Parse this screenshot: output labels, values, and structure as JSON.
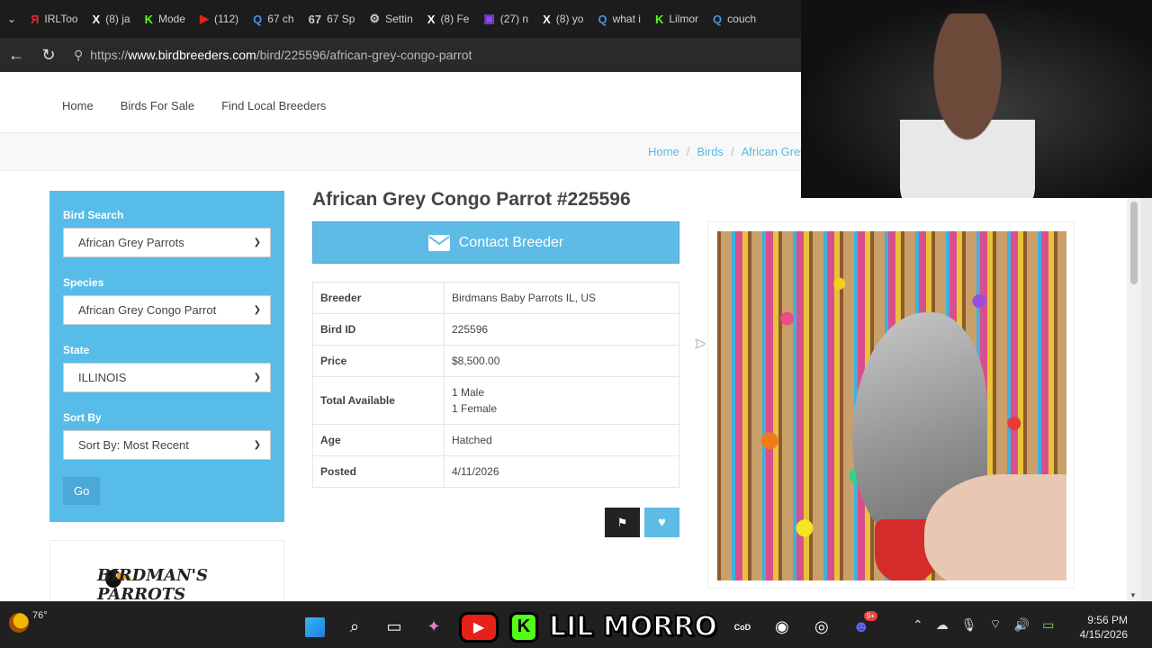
{
  "browser": {
    "tabs": [
      {
        "icon": "Я",
        "icon_color": "#e8262b",
        "label": "IRLToo"
      },
      {
        "icon": "X",
        "icon_color": "#ffffff",
        "label": "(8) ja"
      },
      {
        "icon": "K",
        "icon_color": "#53fc18",
        "label": "Mode"
      },
      {
        "icon": "▶",
        "icon_color": "#e62117",
        "label": "(112)"
      },
      {
        "icon": "Q",
        "icon_color": "#4a90e2",
        "label": "67 ch"
      },
      {
        "icon": "67",
        "icon_color": "#cccccc",
        "label": "67 Sp"
      },
      {
        "icon": "⚙",
        "icon_color": "#cccccc",
        "label": "Settin"
      },
      {
        "icon": "X",
        "icon_color": "#ffffff",
        "label": "(8) Fe"
      },
      {
        "icon": "▣",
        "icon_color": "#9146ff",
        "label": "(27) n"
      },
      {
        "icon": "X",
        "icon_color": "#ffffff",
        "label": "(8) yo"
      },
      {
        "icon": "Q",
        "icon_color": "#4a90e2",
        "label": "what i"
      },
      {
        "icon": "K",
        "icon_color": "#53fc18",
        "label": "Lilmor"
      },
      {
        "icon": "Q",
        "icon_color": "#4a90e2",
        "label": "couch"
      }
    ],
    "url_prefix": "https://",
    "url_host": "www.birdbreeders.com",
    "url_path": "/bird/225596/african-grey-congo-parrot"
  },
  "site": {
    "nav": [
      "Home",
      "Birds For Sale",
      "Find Local Breeders"
    ],
    "breadcrumb": [
      "Home",
      "Birds",
      "African Grey"
    ]
  },
  "search": {
    "title": "Bird Search",
    "bird_value": "African Grey Parrots",
    "species_label": "Species",
    "species_value": "African Grey Congo Parrot",
    "state_label": "State",
    "state_value": "ILLINOIS",
    "sort_label": "Sort By",
    "sort_value": "Sort By: Most Recent",
    "go_label": "Go"
  },
  "logo": {
    "text": "BIRDMAN'S PARROTS"
  },
  "listing": {
    "title": "African Grey Congo Parrot #225596",
    "contact_label": "Contact Breeder",
    "rows": [
      {
        "key": "Breeder",
        "value": "Birdmans Baby Parrots IL, US"
      },
      {
        "key": "Bird ID",
        "value": "225596"
      },
      {
        "key": "Price",
        "value": "$8,500.00"
      },
      {
        "key": "Total Available",
        "value": "1 Male",
        "value2": "1 Female"
      },
      {
        "key": "Age",
        "value": "Hatched"
      },
      {
        "key": "Posted",
        "value": "4/11/2026"
      }
    ]
  },
  "taskbar": {
    "temperature": "76°",
    "overlay_text": "LIL MORRO",
    "time": "9:56 PM",
    "date": "4/15/2026",
    "badge": "9+"
  },
  "colors": {
    "accent": "#57bce8",
    "link": "#5ab8e4"
  }
}
